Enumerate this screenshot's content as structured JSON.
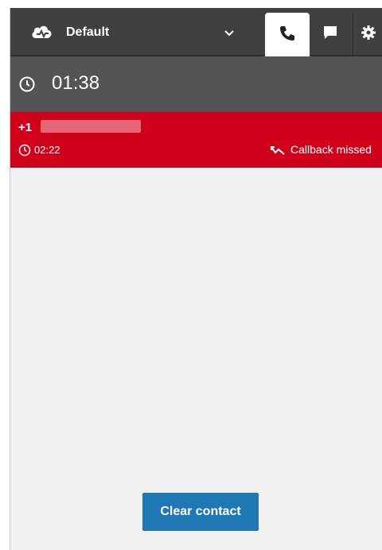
{
  "header": {
    "status_label": "Default",
    "icons": {
      "status": "cloud-icon",
      "dropdown": "chevron-down-icon",
      "phone_tab": "phone-icon",
      "chat_tab": "chat-icon",
      "settings_tab": "gear-icon"
    }
  },
  "timer": {
    "icon": "clock-icon",
    "value": "01:38"
  },
  "contact": {
    "number_prefix": "+1",
    "duration": "02:22",
    "status_text": "Callback missed",
    "card_color": "#d0021b"
  },
  "actions": {
    "clear_contact_label": "Clear contact",
    "button_color": "#1f77b4"
  }
}
